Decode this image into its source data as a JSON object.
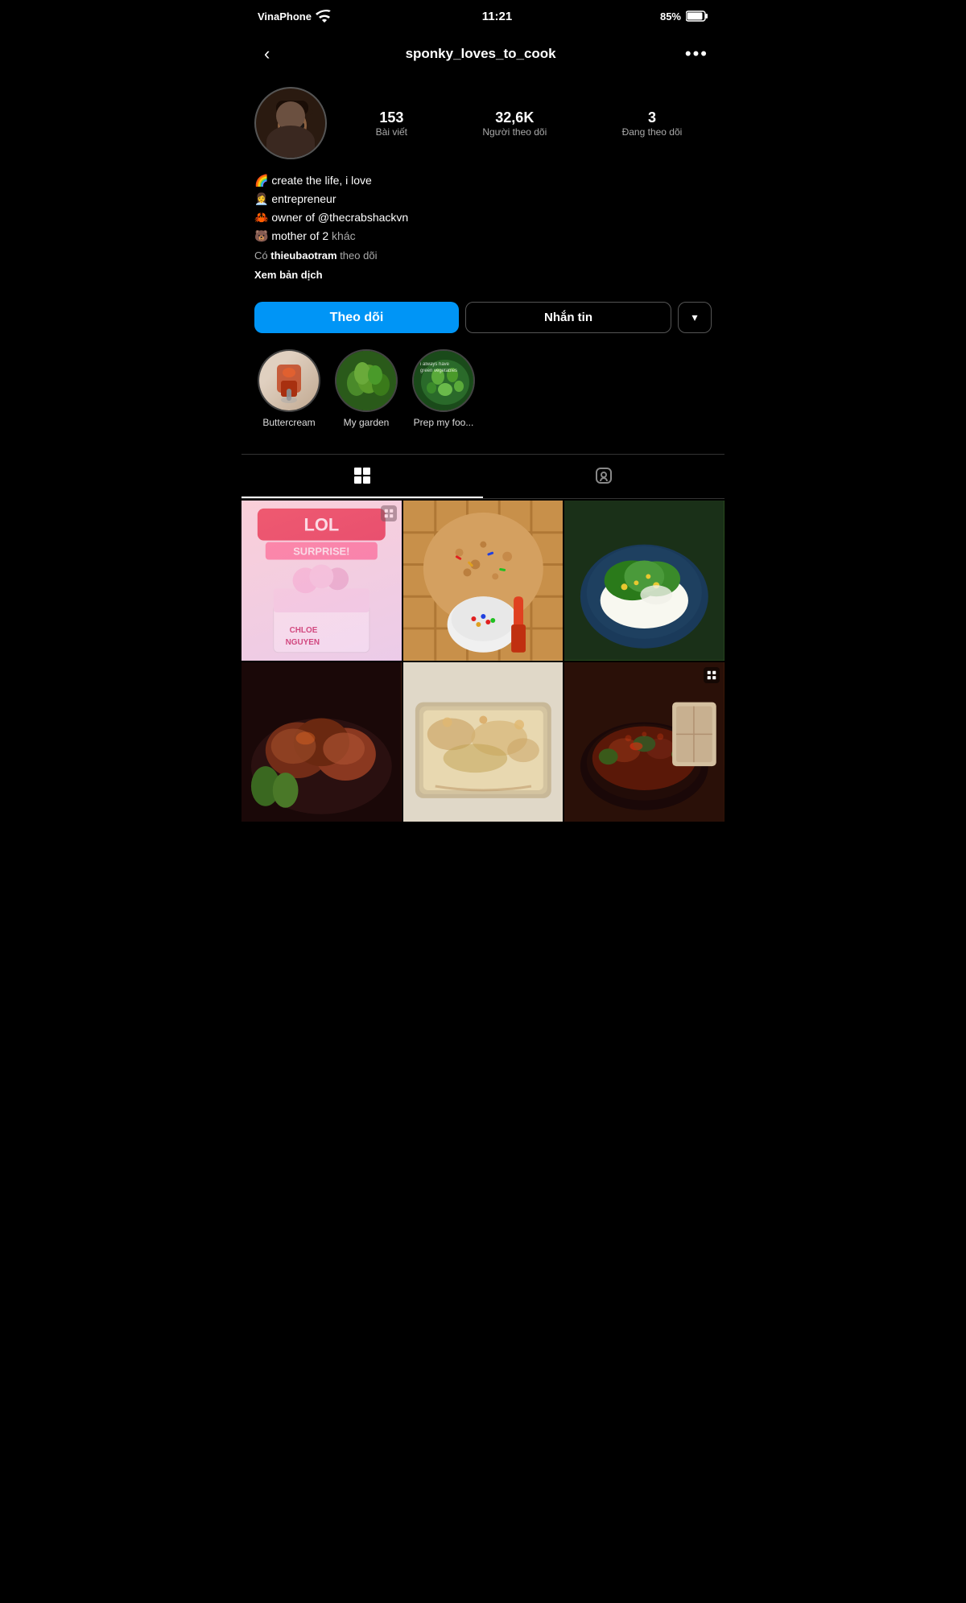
{
  "statusBar": {
    "carrier": "VinaPhone",
    "time": "11:21",
    "battery": "85%",
    "wifi": true
  },
  "header": {
    "backLabel": "‹",
    "username": "sponky_loves_to_cook",
    "moreLabel": "•••"
  },
  "stats": {
    "posts": {
      "value": "153",
      "label": "Bài viết"
    },
    "followers": {
      "value": "32,6K",
      "label": "Người theo dõi"
    },
    "following": {
      "value": "3",
      "label": "Đang theo dõi"
    }
  },
  "bio": {
    "line1": "🌈 create the life, i love",
    "line2": "👩‍💼 entrepreneur",
    "line3": "🦀 owner of @thecrabshackvn",
    "line4": "🐻 mother of 2",
    "moreLabel": "khác",
    "followerText": "Có ",
    "followerName": "thieubaotram",
    "followerSuffix": " theo dõi",
    "translateLabel": "Xem bản dịch"
  },
  "buttons": {
    "follow": "Theo dõi",
    "message": "Nhắn tin",
    "dropdownArrow": "▾"
  },
  "highlights": [
    {
      "label": "Buttercream",
      "colorClass": "hl-img-1"
    },
    {
      "label": "My garden",
      "colorClass": "hl-img-2"
    },
    {
      "label": "Prep my foo...",
      "colorClass": "hl-img-3"
    }
  ],
  "tabs": [
    {
      "id": "grid",
      "active": true
    },
    {
      "id": "tagged",
      "active": false
    }
  ],
  "grid": {
    "items": [
      {
        "id": "lol-cake",
        "colorClass": "grid-lol",
        "hasMulti": true
      },
      {
        "id": "cookie",
        "colorClass": "grid-cookie",
        "hasMulti": false
      },
      {
        "id": "rice-veg",
        "colorClass": "grid-rice",
        "hasMulti": false
      },
      {
        "id": "chicken",
        "colorClass": "grid-chicken",
        "hasMulti": false
      },
      {
        "id": "casserole",
        "colorClass": "grid-casserole",
        "hasMulti": false
      },
      {
        "id": "soup",
        "colorClass": "grid-soup",
        "hasMulti": true
      }
    ]
  },
  "colors": {
    "followBtn": "#0095f6",
    "accent": "#0095f6"
  }
}
